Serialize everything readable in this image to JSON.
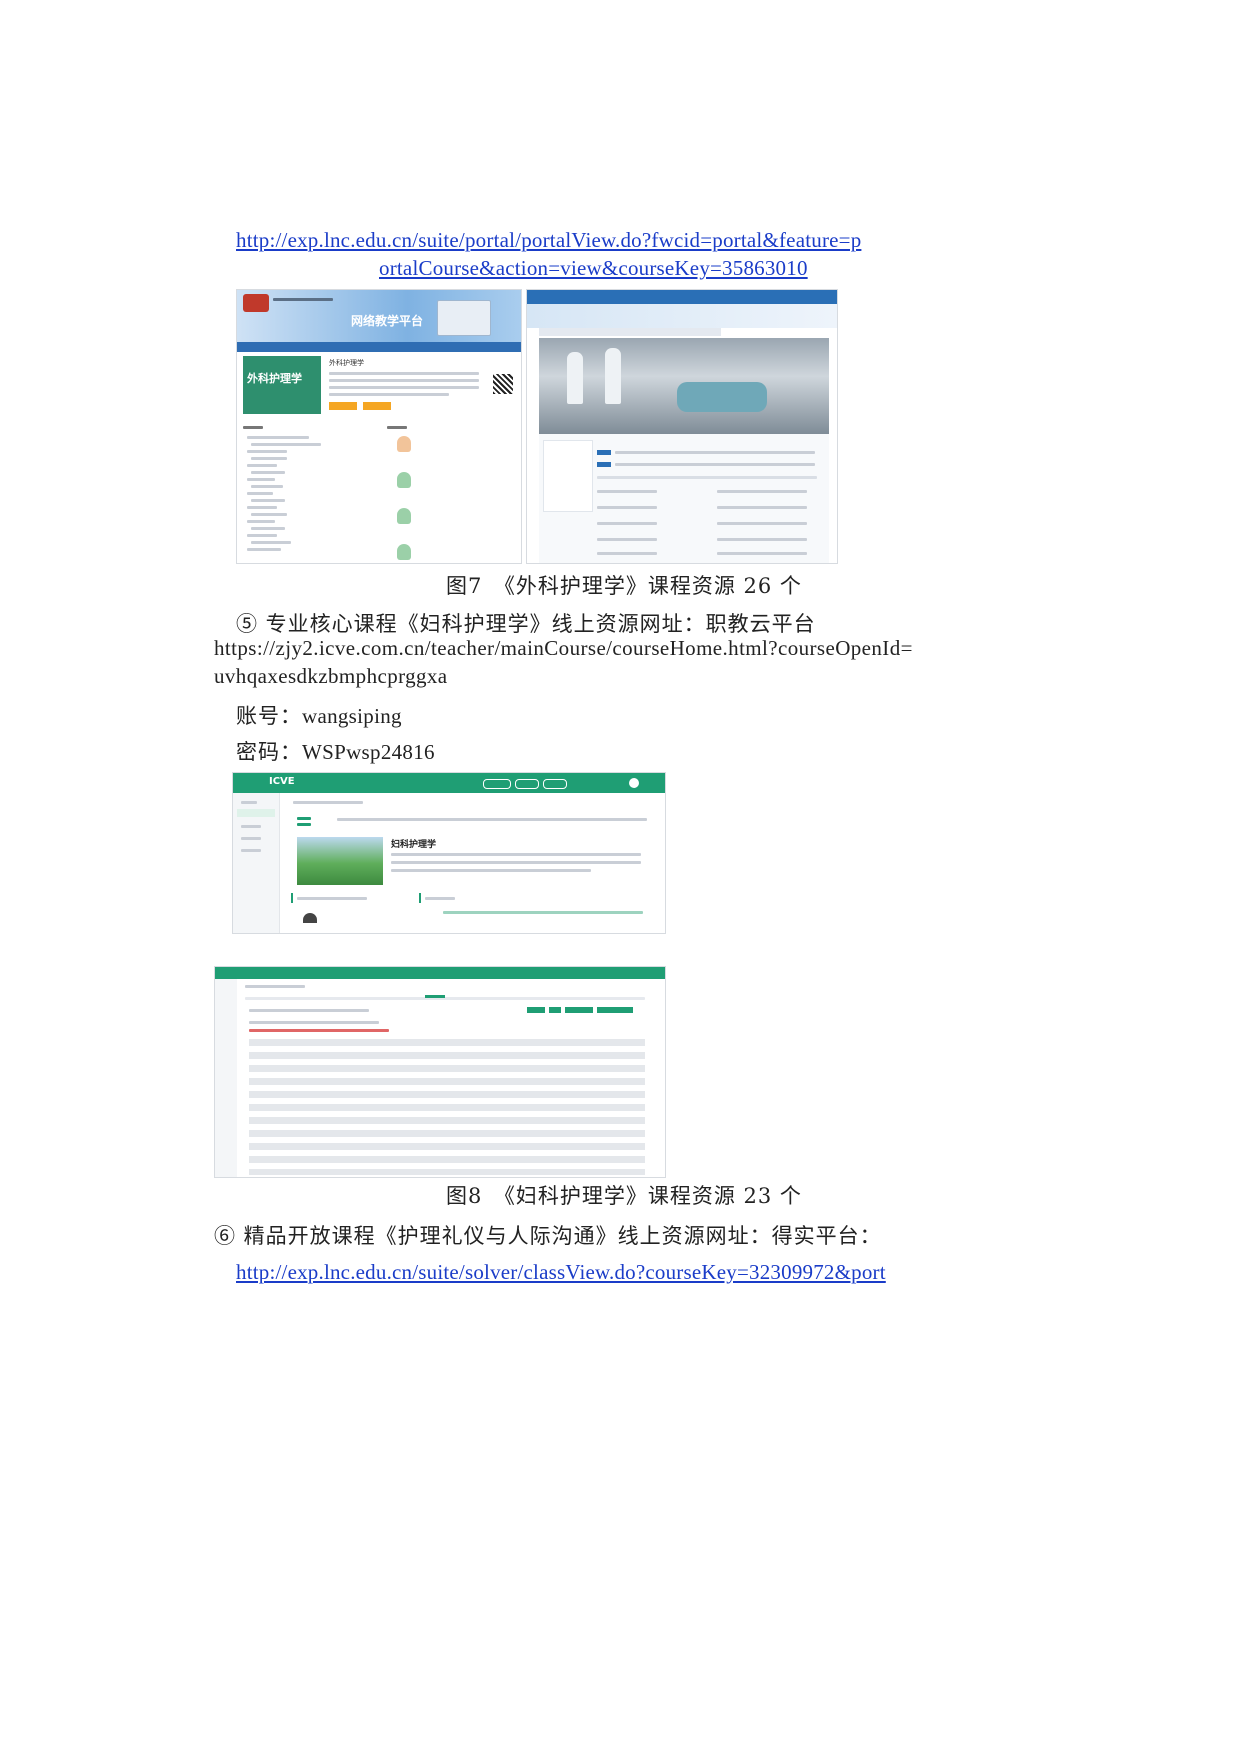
{
  "link1": {
    "line1": "http://exp.lnc.edu.cn/suite/portal/portalView.do?fwcid=portal&feature=p",
    "line2": "ortalCourse&action=view&courseKey=35863010"
  },
  "figure7": {
    "left": {
      "banner_title": "网络教学平台",
      "course_cover_text": "外科护理学",
      "course_name": "外科护理学"
    },
    "caption": "图7　《外科护理学》课程资源 26 个"
  },
  "item5": {
    "heading": "⑤ 专业核心课程《妇科护理学》线上资源网址：职教云平台",
    "url_line1": "https://zjy2.icve.com.cn/teacher/mainCourse/courseHome.html?courseOpenId=",
    "url_line2": "uvhqaxesdkzbmphcprggxa",
    "account_label": "账号：",
    "account_value": "wangsiping",
    "password_label": "密码：",
    "password_value": "WSPwsp24816"
  },
  "figure8": {
    "top": {
      "logo": "ICVE",
      "course_title": "妇科护理学"
    },
    "caption": "图8　《妇科护理学》课程资源 23 个"
  },
  "item6": {
    "heading": "⑥ 精品开放课程《护理礼仪与人际沟通》线上资源网址：得实平台：",
    "url": "http://exp.lnc.edu.cn/suite/solver/classView.do?courseKey=32309972&port"
  },
  "colors": {
    "link": "#1a3cc8",
    "icve_green": "#1f9e74",
    "portal_blue": "#2f6db3"
  }
}
